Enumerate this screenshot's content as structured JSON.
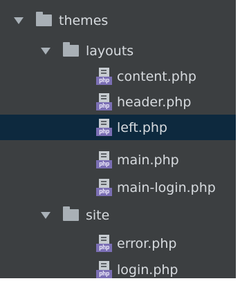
{
  "tree": {
    "root": {
      "label": "themes",
      "icon": "folder-icon",
      "expanded": true
    },
    "layouts": {
      "label": "layouts",
      "icon": "folder-icon",
      "expanded": true
    },
    "layouts_files": [
      {
        "label": "content.php",
        "badge": "php",
        "icon": "php-file-icon"
      },
      {
        "label": "header.php",
        "badge": "php",
        "icon": "php-file-icon"
      },
      {
        "label": "left.php",
        "badge": "php",
        "icon": "php-file-icon",
        "selected": true
      },
      {
        "label": "main.php",
        "badge": "php",
        "icon": "php-file-icon"
      },
      {
        "label": "main-login.php",
        "badge": "php",
        "icon": "php-file-icon"
      }
    ],
    "site": {
      "label": "site",
      "icon": "folder-icon",
      "expanded": true
    },
    "site_files": [
      {
        "label": "error.php",
        "badge": "php",
        "icon": "php-file-icon"
      },
      {
        "label": "login.php",
        "badge": "php",
        "icon": "php-file-icon"
      }
    ]
  },
  "colors": {
    "panel_background": "#3c3f41",
    "selected_row": "#0d293e",
    "text": "#d7dbdf",
    "folder": "#a9b0b6",
    "php_badge": "#7b6fb4"
  }
}
